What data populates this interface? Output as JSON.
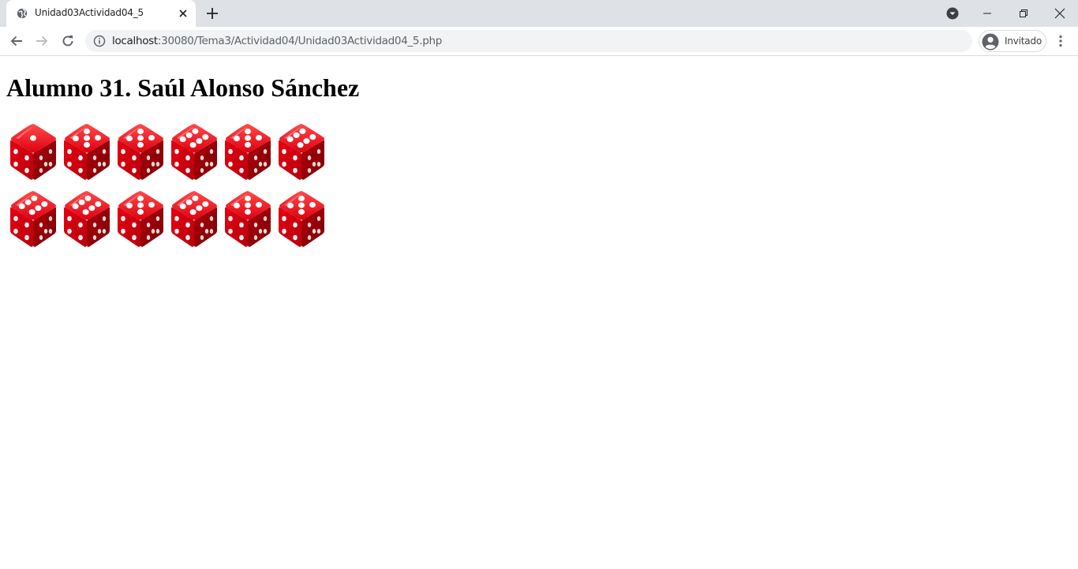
{
  "browser": {
    "tab": {
      "title": "Unidad03Actividad04_5",
      "favicon": "globe-icon"
    },
    "address_bar": {
      "host": "localhost",
      "path": ":30080/Tema3/Actividad04/Unidad03Actividad04_5.php"
    },
    "profile": {
      "label": "Invitado"
    }
  },
  "page": {
    "heading": "Alumno 31. Saúl Alonso Sánchez",
    "dice": {
      "color": "#e00010",
      "rows": [
        [
          1,
          5,
          5,
          6,
          5,
          6
        ],
        [
          6,
          6,
          5,
          6,
          5,
          5
        ]
      ]
    }
  }
}
